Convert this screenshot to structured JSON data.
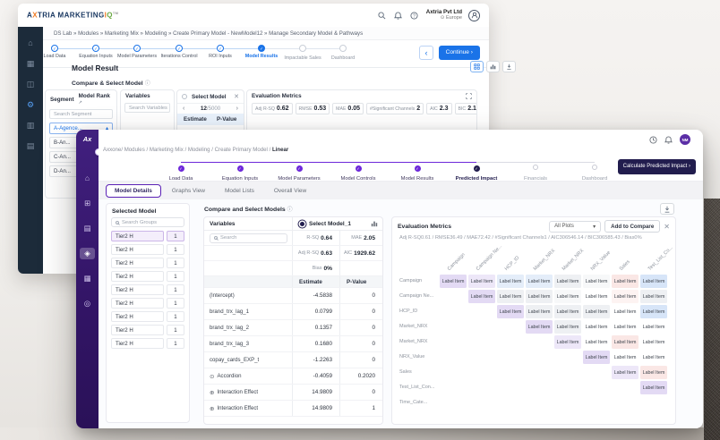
{
  "colors": {
    "accent_blue": "#1a73e8",
    "accent_purple": "#6d28d9",
    "dark_button": "#221d4e",
    "back_sidebar": "#1c2b3a"
  },
  "back_window": {
    "logo": {
      "a": "A",
      "x": "X",
      "tria": "TRIA ",
      "marketing": "MARKETING",
      "i": "I",
      "q": "Q",
      "tm": "TM"
    },
    "account": {
      "name": "Axtria Pvt Ltd",
      "region": "Europe"
    },
    "breadcrumb": "DS Lab » Modules » Marketing Mix » Modeling » Create Primary Model - NewModel12 » Manage Secondary Model & Pathways",
    "sidebar_icons": [
      "home",
      "apps",
      "box",
      "settings",
      "chart",
      "docs"
    ],
    "sidebar_active_index": 3,
    "stepper": {
      "steps": [
        {
          "label": "Load Data",
          "state": "done"
        },
        {
          "label": "Equation Inputs",
          "state": "done"
        },
        {
          "label": "Model Parameters",
          "state": "done"
        },
        {
          "label": "Iterations Control",
          "state": "done"
        },
        {
          "label": "ROI Inputs",
          "state": "done"
        },
        {
          "label": "Model Results",
          "state": "active"
        },
        {
          "label": "Impactable Sales",
          "state": "pending"
        },
        {
          "label": "Dashboard",
          "state": "pending"
        }
      ],
      "back_label": "‹",
      "continue_label": "Continue ›"
    },
    "title": "Model Result",
    "subtitle": "Compare & Select Model",
    "segment_panel": {
      "col_segment": "Segment",
      "col_model_rank": "Model Rank",
      "search_placeholder": "Search Segment",
      "selected_item": "A-Agence...",
      "selected_caret": "▴",
      "items": [
        "B-An...",
        "C-An...",
        "D-An..."
      ]
    },
    "variables_panel": {
      "title": "Variables",
      "search_placeholder": "Search Variables"
    },
    "select_model_panel": {
      "title": "Select Model",
      "close": "✕",
      "prev": "‹",
      "next": "›",
      "page_current": "12",
      "page_total": "/5000",
      "col_estimate": "Estimate",
      "col_pvalue": "P-Value"
    },
    "metrics_panel": {
      "title": "Evaluation Metrics",
      "chips": [
        {
          "label": "Adj R-SQ",
          "value": "0.62"
        },
        {
          "label": "RMSE",
          "value": "0.53"
        },
        {
          "label": "MAE",
          "value": "0.05"
        },
        {
          "label": "#Significant Channels",
          "value": "2"
        },
        {
          "label": "AIC",
          "value": "2.3"
        },
        {
          "label": "BIC",
          "value": "2.1"
        }
      ]
    }
  },
  "front_window": {
    "logo": "Ax",
    "avatar_initials": "NM",
    "breadcrumb": {
      "path": "Axxone/ Modules / Marketing Mix / Modeling / Create Primary Model / ",
      "current": "Linear"
    },
    "sidebar_icons": [
      "home",
      "dashboard",
      "list",
      "diamond",
      "grid",
      "target"
    ],
    "sidebar_active_index": 3,
    "stepper": {
      "steps": [
        {
          "label": "Load Data",
          "state": "done"
        },
        {
          "label": "Equation Inputs",
          "state": "done"
        },
        {
          "label": "Model Parameters",
          "state": "done"
        },
        {
          "label": "Model Controls",
          "state": "done"
        },
        {
          "label": "Model Results",
          "state": "done"
        },
        {
          "label": "Predicted Impact",
          "state": "active"
        },
        {
          "label": "Financials",
          "state": "pending"
        },
        {
          "label": "Dashboard",
          "state": "pending"
        }
      ],
      "action_label": "Calculate Predicted Impact ›"
    },
    "tabs": [
      {
        "label": "Model Details",
        "active": true
      },
      {
        "label": "Graphs View",
        "active": false
      },
      {
        "label": "Model Lists",
        "active": false
      },
      {
        "label": "Overall View",
        "active": false
      }
    ],
    "selected_model": {
      "title": "Selected Model",
      "search_placeholder": "Search Groups",
      "rows": [
        {
          "group": "Tier2 H",
          "count": "1",
          "active": true
        },
        {
          "group": "Tier2 H",
          "count": "1",
          "active": false
        },
        {
          "group": "Tier2 H",
          "count": "1",
          "active": false
        },
        {
          "group": "Tier2 H",
          "count": "1",
          "active": false
        },
        {
          "group": "Tier2 H",
          "count": "1",
          "active": false
        },
        {
          "group": "Tier2 H",
          "count": "1",
          "active": false
        },
        {
          "group": "Tier2 H",
          "count": "1",
          "active": false
        },
        {
          "group": "Tier2 H",
          "count": "1",
          "active": false
        },
        {
          "group": "Tier2 H",
          "count": "1",
          "active": false
        }
      ]
    },
    "compare_section": {
      "title": "Compare and Select Models",
      "variables_header": "Variables",
      "search_placeholder": "Search",
      "model_header": "Select Model_1",
      "metric_rows": [
        [
          {
            "label": "R-SQ",
            "value": "0.64"
          },
          {
            "label": "MAE",
            "value": "2.05"
          }
        ],
        [
          {
            "label": "Adj R-SQ",
            "value": "0.63"
          },
          {
            "label": "AIC",
            "value": "1929.62"
          }
        ],
        [
          {
            "label": "Bias",
            "value": "0%"
          },
          null
        ]
      ],
      "col_estimate": "Estimate",
      "col_pvalue": "P-Value",
      "rows": [
        {
          "variable": "(Intercept)",
          "icon": null,
          "estimate": "-4.5838",
          "pvalue": "0"
        },
        {
          "variable": "brand_trx_lag_1",
          "icon": null,
          "estimate": "0.0799",
          "pvalue": "0"
        },
        {
          "variable": "brand_trx_lag_2",
          "icon": null,
          "estimate": "0.1357",
          "pvalue": "0"
        },
        {
          "variable": "brand_trx_lag_3",
          "icon": null,
          "estimate": "0.1680",
          "pvalue": "0"
        },
        {
          "variable": "copay_cards_EXP_t",
          "icon": null,
          "estimate": "-1.2263",
          "pvalue": "0"
        },
        {
          "variable": "Accordion",
          "icon": "accordion-icon",
          "estimate": "-0.4059",
          "pvalue": "0.2020"
        },
        {
          "variable": "Interaction Effect",
          "icon": "interaction-icon",
          "estimate": "14.9809",
          "pvalue": "0"
        },
        {
          "variable": "Interaction Effect",
          "icon": "interaction-icon",
          "estimate": "14.9809",
          "pvalue": "1"
        }
      ]
    },
    "evaluation": {
      "title": "Evaluation Metrics",
      "plots_dropdown": "All Plots",
      "add_button": "Add to Compare",
      "close": "✕",
      "metrics_line": "Adj R-SQ0.61  /  RMSE36.49  /  MAE72.42  /  #Significant Channels1  /  AIC306546.14  /  BIC306585.43  /  Bias0%",
      "heatmap": {
        "cell_label": "Label Item",
        "columns": [
          "Campaign",
          "Campaign Ne...",
          "HCP_ID",
          "Market_NRX",
          "Market_NRX",
          "NRX_Value",
          "Sales",
          "Test_List_Co..."
        ],
        "rows": [
          "Campaign",
          "Campaign Ne...",
          "HCP_ID",
          "Market_NRX",
          "Market_NRX",
          "NRX_Value",
          "Sales",
          "Test_List_Con...",
          "Time_Cate..."
        ],
        "palette": {
          "p2": "#e3daf4",
          "p1": "#ede7f8",
          "b1": "#e4edf9",
          "b2": "#d7e5f8",
          "g1": "#eef0f3",
          "g0": "#f7f8f9",
          "w": "#ffffff",
          "r1": "#fae7e5",
          "r0": "#fdf3f2"
        },
        "cells": [
          [
            "p2",
            "p1",
            "b1",
            "b1",
            "g1",
            "g0",
            "r1",
            "b2"
          ],
          [
            null,
            "p2",
            "g1",
            "g1",
            "g0",
            "w",
            "r0",
            "g1"
          ],
          [
            null,
            null,
            "p2",
            "g1",
            "g1",
            "g1",
            "w",
            "b2"
          ],
          [
            null,
            null,
            null,
            "p2",
            "g1",
            "w",
            "w",
            "w"
          ],
          [
            null,
            null,
            null,
            null,
            "p1",
            "w",
            "r1",
            "w"
          ],
          [
            null,
            null,
            null,
            null,
            null,
            "p2",
            "w",
            "w"
          ],
          [
            null,
            null,
            null,
            null,
            null,
            null,
            "p1",
            "r1"
          ],
          [
            null,
            null,
            null,
            null,
            null,
            null,
            null,
            "p2"
          ],
          [
            null,
            null,
            null,
            null,
            null,
            null,
            null,
            null
          ]
        ]
      }
    }
  }
}
